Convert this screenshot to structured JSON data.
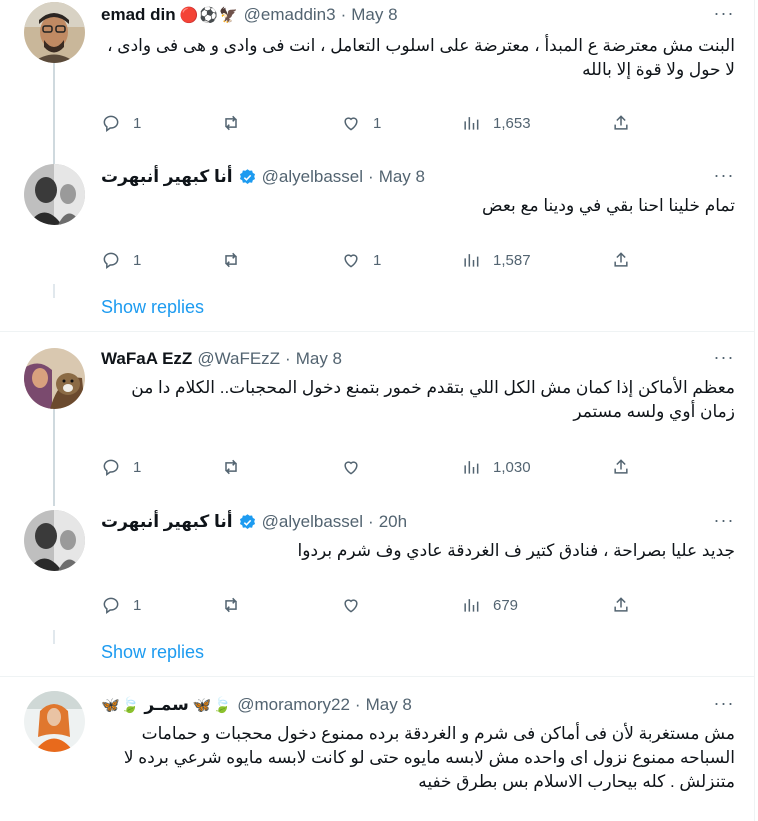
{
  "tweets": [
    {
      "name": "emad din",
      "emoji": "🔴⚽🦅",
      "handle": "@emaddin3",
      "dot": "·",
      "time": "May 8",
      "text": "البنت مش معترضة ع المبدأ ، معترضة على اسلوب التعامل ، انت فى وادى و هى فى وادى ، لا حول ولا قوة إلا بالله",
      "replies": "1",
      "reposts": "",
      "likes": "1",
      "views": "1,653"
    },
    {
      "name": "أنا كبهير أنبهرت",
      "handle": "@alyelbassel",
      "dot": "·",
      "time": "May 8",
      "text": "تمام خلينا احنا بقي في ودينا مع بعض",
      "replies": "1",
      "reposts": "",
      "likes": "1",
      "views": "1,587"
    },
    {
      "name": "WaFaA EzZ",
      "handle": "@WaFEzZ",
      "dot": "·",
      "time": "May 8",
      "text": "معظم الأماكن إذا كمان مش الكل اللي بتقدم خمور بتمنع دخول المحجبات.. الكلام دا من زمان أوي ولسه مستمر",
      "replies": "1",
      "reposts": "",
      "likes": "",
      "views": "1,030"
    },
    {
      "name": "أنا كبهير أنبهرت",
      "handle": "@alyelbassel",
      "dot": "·",
      "time": "20h",
      "text": "جديد عليا بصراحة ، فنادق كتير ف الغردقة عادي وف شرم بردوا",
      "replies": "1",
      "reposts": "",
      "likes": "",
      "views": "679"
    },
    {
      "name": "سمـر",
      "emoji_left": "🦋🍃",
      "emoji_right": "🦋🍃",
      "handle": "@moramory22",
      "dot": "·",
      "time": "May 8",
      "text": "مش مستغربة لأن فى أماكن فى شرم و الغردقة برده  ممنوع دخول محجبات و حمامات السباحه ممنوع نزول اى واحده مش لابسه مايوه حتى لو كانت لابسه مايوه شرعي برده لا متنزلش . كله بيحارب الاسلام بس بطرق خفيه"
    }
  ],
  "show_replies": "Show replies",
  "more_glyph": "···",
  "colors": {
    "accent": "#1d9bf0",
    "muted": "#536471",
    "line": "#cfd9de",
    "border": "#eff3f4"
  },
  "icons": [
    "reply-icon",
    "repost-icon",
    "like-icon",
    "views-icon",
    "share-icon",
    "verified-badge-icon",
    "more-icon"
  ]
}
